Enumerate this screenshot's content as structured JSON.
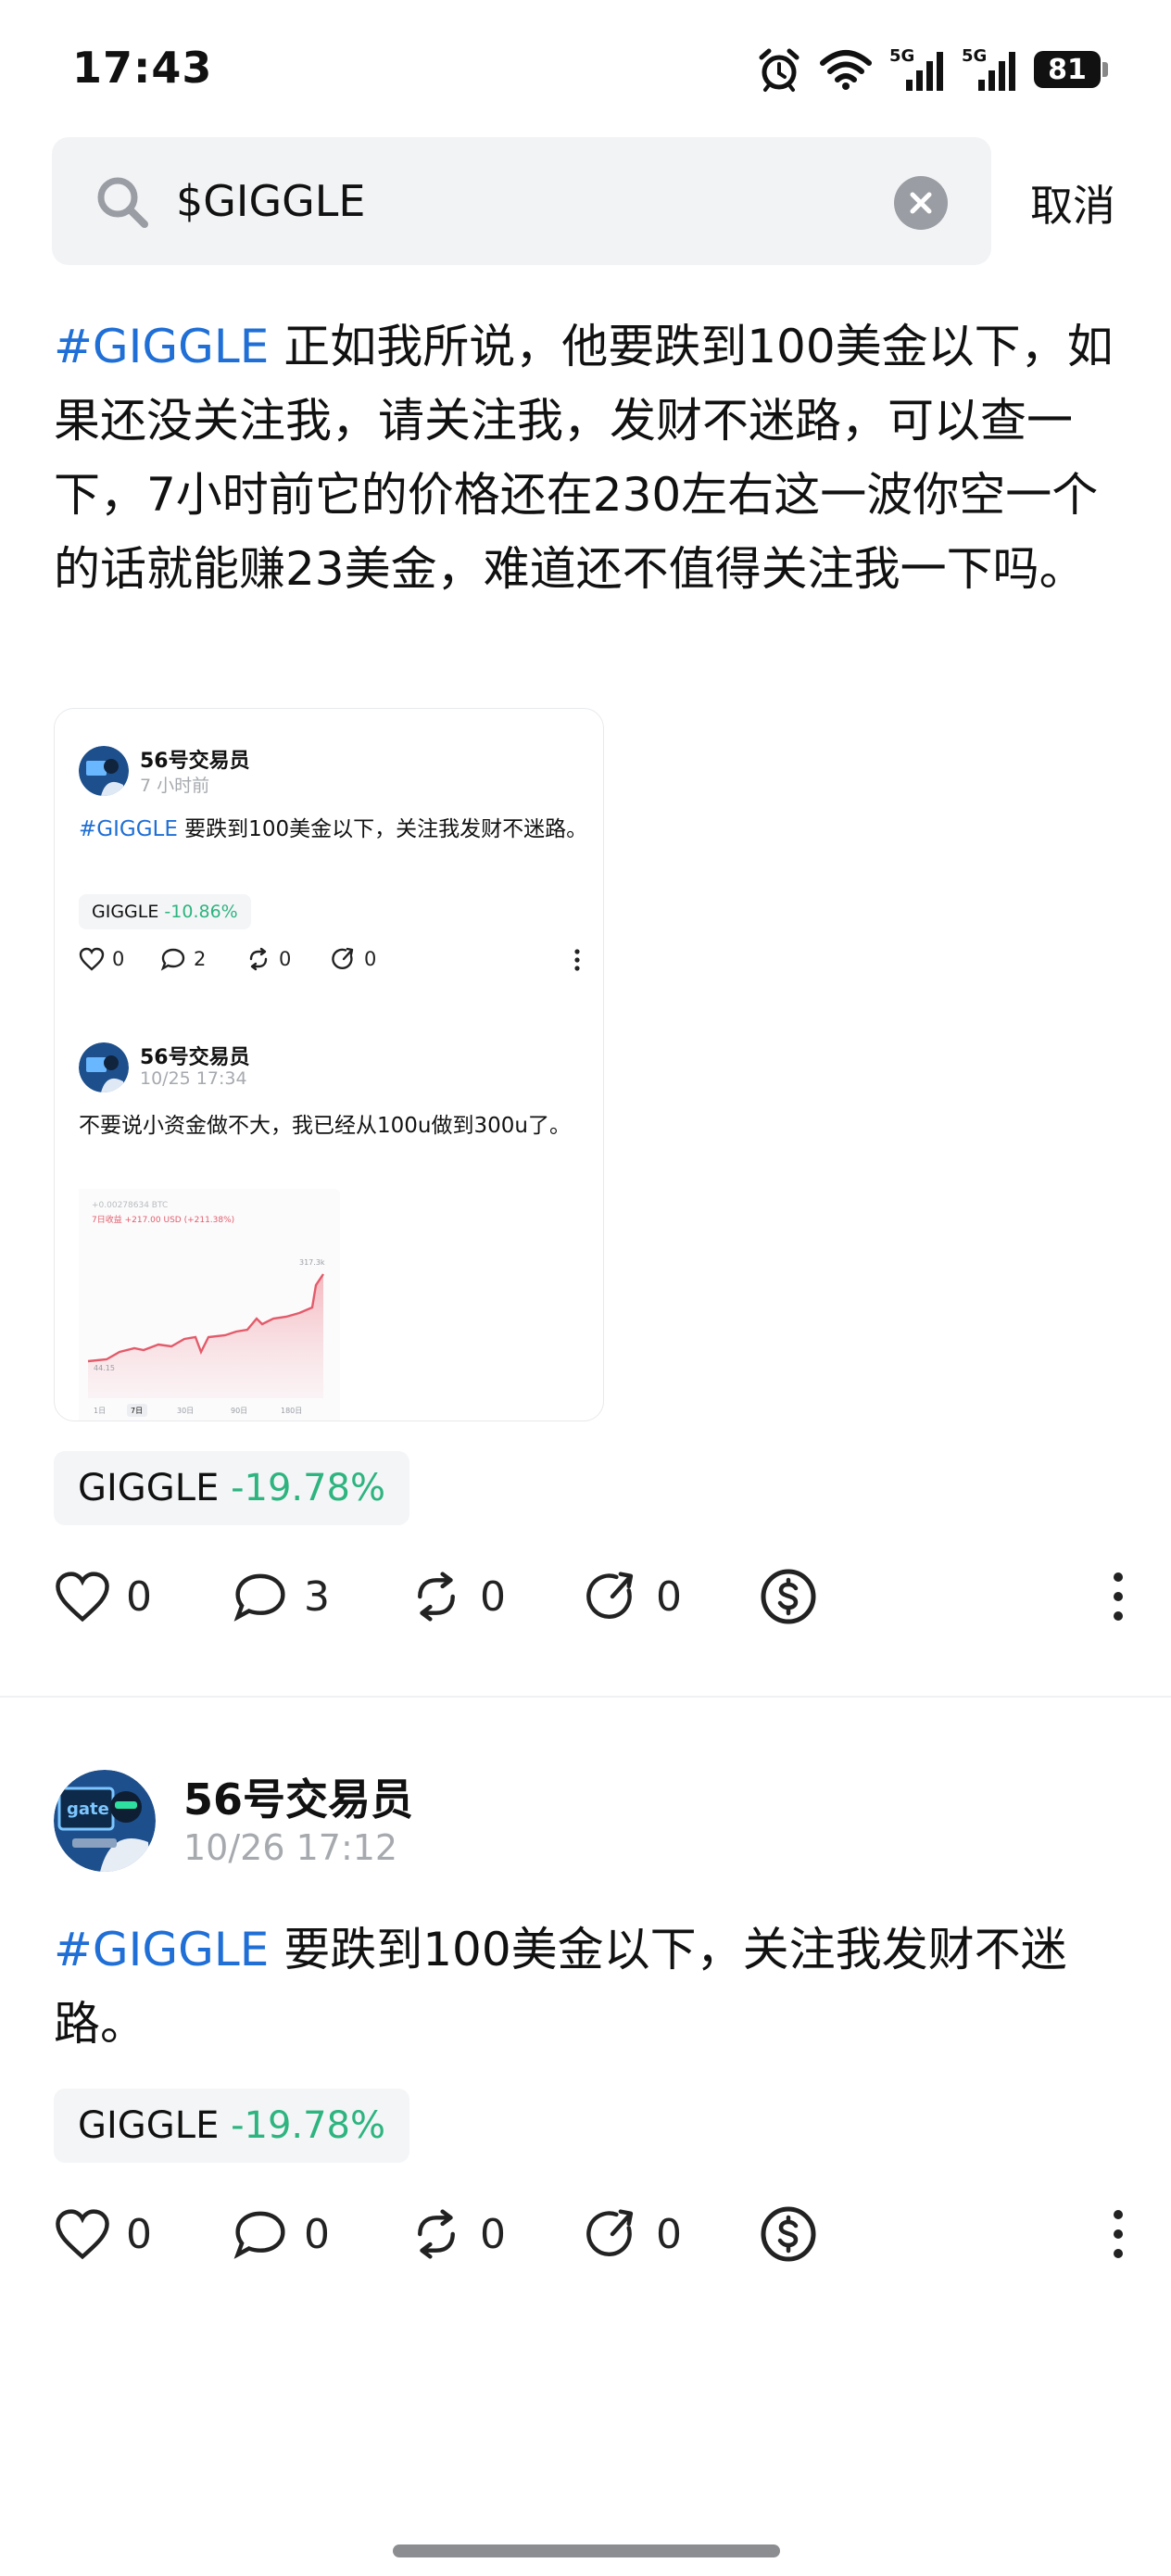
{
  "status_bar": {
    "time": "17:43",
    "signal_1": "5G",
    "signal_2": "5G",
    "battery": "81",
    "icons": [
      "alarm-icon",
      "wifi-icon",
      "signal-5g-icon",
      "signal-5g-icon",
      "battery-icon"
    ]
  },
  "search": {
    "query": "$GIGGLE",
    "cancel_label": "取消"
  },
  "post1": {
    "hashtag": "#GIGGLE",
    "text": " 正如我所说，他要跌到100美金以下，如果还没关注我，请关注我，发财不迷路，可以查一下，7小时前它的价格还在230左右这一波你空一个的话就能赚23美金，难道还不值得关注我一下吗。",
    "embed": {
      "item1": {
        "author": "56号交易员",
        "time": "7 小时前",
        "hashtag": "#GIGGLE",
        "text": " 要跌到100美金以下，关注我发财不迷路。",
        "ticker": "GIGGLE",
        "change": "-10.86%",
        "likes": "0",
        "comments": "2",
        "reposts": "0",
        "shares": "0"
      },
      "item2": {
        "author": "56号交易员",
        "time": "10/25 17:34",
        "text": "不要说小资金做不大，我已经从100u做到300u了。",
        "chart": {
          "header_value": "+0.00278634 BTC",
          "header_change": "7日收益 +217.00 USD (+211.38%)",
          "high_label": "317.3k",
          "low_label": "44.15",
          "tabs": [
            "1日",
            "7日",
            "30日",
            "90日",
            "180日"
          ],
          "active_tab": "7日",
          "line_color": "#e35b6a"
        }
      }
    },
    "ticker": "GIGGLE",
    "change": "-19.78%",
    "likes": "0",
    "comments": "3",
    "reposts": "0",
    "shares": "0"
  },
  "post2": {
    "author": "56号交易员",
    "time": "10/26 17:12",
    "hashtag": "#GIGGLE",
    "text": " 要跌到100美金以下，关注我发财不迷路。",
    "ticker": "GIGGLE",
    "change": "-19.78%",
    "likes": "0",
    "comments": "0",
    "reposts": "0",
    "shares": "0"
  },
  "colors": {
    "hashtag": "#1f6fd6",
    "positive_change_text": "#2db47f",
    "muted": "#a6a9ae"
  }
}
